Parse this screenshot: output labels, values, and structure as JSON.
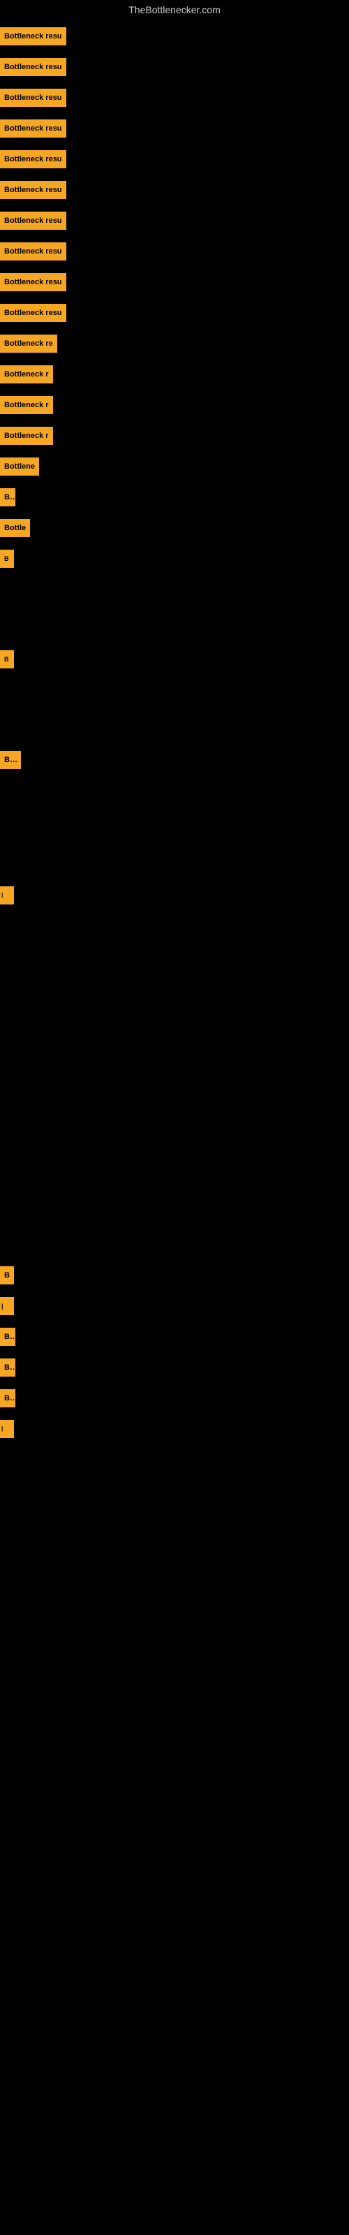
{
  "site": {
    "title": "TheBottlenecker.com"
  },
  "items": [
    {
      "id": 1,
      "label": "Bottleneck resu",
      "row_class": "row-1"
    },
    {
      "id": 2,
      "label": "Bottleneck resu",
      "row_class": "row-2"
    },
    {
      "id": 3,
      "label": "Bottleneck resu",
      "row_class": "row-3"
    },
    {
      "id": 4,
      "label": "Bottleneck resu",
      "row_class": "row-4"
    },
    {
      "id": 5,
      "label": "Bottleneck resu",
      "row_class": "row-5"
    },
    {
      "id": 6,
      "label": "Bottleneck resu",
      "row_class": "row-6"
    },
    {
      "id": 7,
      "label": "Bottleneck resu",
      "row_class": "row-7"
    },
    {
      "id": 8,
      "label": "Bottleneck resu",
      "row_class": "row-8"
    },
    {
      "id": 9,
      "label": "Bottleneck resu",
      "row_class": "row-9"
    },
    {
      "id": 10,
      "label": "Bottleneck resu",
      "row_class": "row-10"
    },
    {
      "id": 11,
      "label": "Bottleneck re",
      "row_class": "row-11"
    },
    {
      "id": 12,
      "label": "Bottleneck r",
      "row_class": "row-12"
    },
    {
      "id": 13,
      "label": "Bottleneck r",
      "row_class": "row-13"
    },
    {
      "id": 14,
      "label": "Bottleneck r",
      "row_class": "row-14"
    },
    {
      "id": 15,
      "label": "Bottlene",
      "row_class": "row-15"
    },
    {
      "id": 16,
      "label": "Bo",
      "row_class": "row-16"
    },
    {
      "id": 17,
      "label": "Bottle",
      "row_class": "row-17"
    },
    {
      "id": 18,
      "label": "B",
      "row_class": "row-18"
    }
  ],
  "items_after_gap1": [
    {
      "id": 19,
      "label": "B",
      "row_class": "row-19"
    }
  ],
  "items_after_gap2": [
    {
      "id": 20,
      "label": "Bot",
      "row_class": "row-20"
    }
  ],
  "items_after_gap3": [
    {
      "id": 21,
      "label": "|",
      "row_class": "row-21"
    }
  ],
  "items_after_gap4": [
    {
      "id": 22,
      "label": "B",
      "row_class": "row-22"
    },
    {
      "id": 23,
      "label": "|",
      "row_class": "row-23"
    },
    {
      "id": 24,
      "label": "Bo",
      "row_class": "row-24"
    },
    {
      "id": 25,
      "label": "Bo",
      "row_class": "row-25"
    },
    {
      "id": 26,
      "label": "Bo",
      "row_class": "row-26"
    },
    {
      "id": 27,
      "label": "|",
      "row_class": "row-27"
    }
  ]
}
